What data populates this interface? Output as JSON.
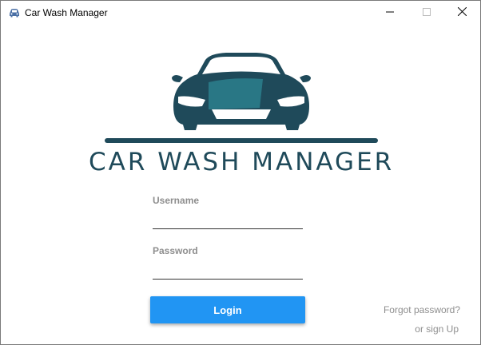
{
  "window": {
    "title": "Car Wash Manager",
    "icon": "car-icon",
    "controls": [
      "minimize-icon",
      "maximize-icon",
      "close-icon"
    ]
  },
  "logo": {
    "text": "CAR WASH MANAGER",
    "colors": {
      "primary": "#1f4a5a",
      "highlight": "#2a7c8a"
    }
  },
  "form": {
    "username_label": "Username",
    "username_value": "",
    "password_label": "Password",
    "password_value": "",
    "login_label": "Login"
  },
  "links": {
    "forgot": "Forgot password?",
    "signup": "or sign Up"
  },
  "colors": {
    "accent": "#2195f3",
    "muted_text": "#8e8e8e"
  }
}
